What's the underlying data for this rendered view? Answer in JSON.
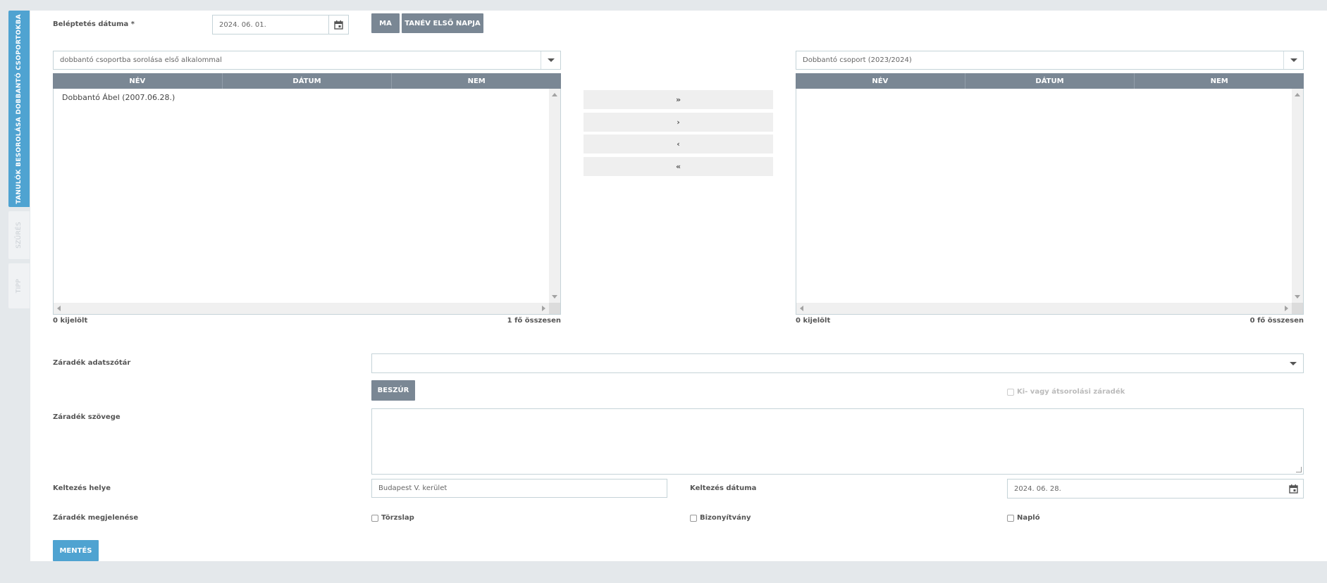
{
  "tabs": [
    {
      "label": "TANULÓK BESOROLÁSA DOBBANTÓ CSOPORTOKBA"
    },
    {
      "label": "SZŰRÉS"
    },
    {
      "label": "TIPP"
    }
  ],
  "enrollment": {
    "label": "Beléptetés dátuma",
    "required_mark": "*",
    "date_value": "2024. 06. 01.",
    "today_button": "MA",
    "first_day_button": "TANÉV ELSŐ NAPJA"
  },
  "left_list": {
    "dropdown_value": "dobbantó csoportba sorolása első alkalommal",
    "columns": [
      "NÉV",
      "DÁTUM",
      "NEM"
    ],
    "rows": [
      "Dobbantó Ábel (2007.06.28.)"
    ],
    "selected_text": "0 kijelölt",
    "total_text": "1 fő összesen"
  },
  "right_list": {
    "dropdown_value": "Dobbantó csoport (2023/2024)",
    "columns": [
      "NÉV",
      "DÁTUM",
      "NEM"
    ],
    "rows": [],
    "selected_text": "0 kijelölt",
    "total_text": "0 fő összesen"
  },
  "move_buttons": {
    "all_right": "»",
    "one_right": "›",
    "one_left": "‹",
    "all_left": "«"
  },
  "clause": {
    "dictionary_label": "Záradék adatszótár",
    "dictionary_value": "",
    "insert_button": "BESZÚR",
    "transfer_checkbox": "Ki- vagy átsorolási záradék",
    "text_label": "Záradék szövege",
    "text_value": ""
  },
  "dating": {
    "place_label": "Keltezés helye",
    "place_value": "Budapest V. kerület",
    "date_label": "Keltezés dátuma",
    "date_value": "2024. 06. 28."
  },
  "appearance": {
    "label": "Záradék megjelenése",
    "options": [
      "Törzslap",
      "Bizonyítvány",
      "Napló"
    ]
  },
  "save_button": "MENTÉS"
}
